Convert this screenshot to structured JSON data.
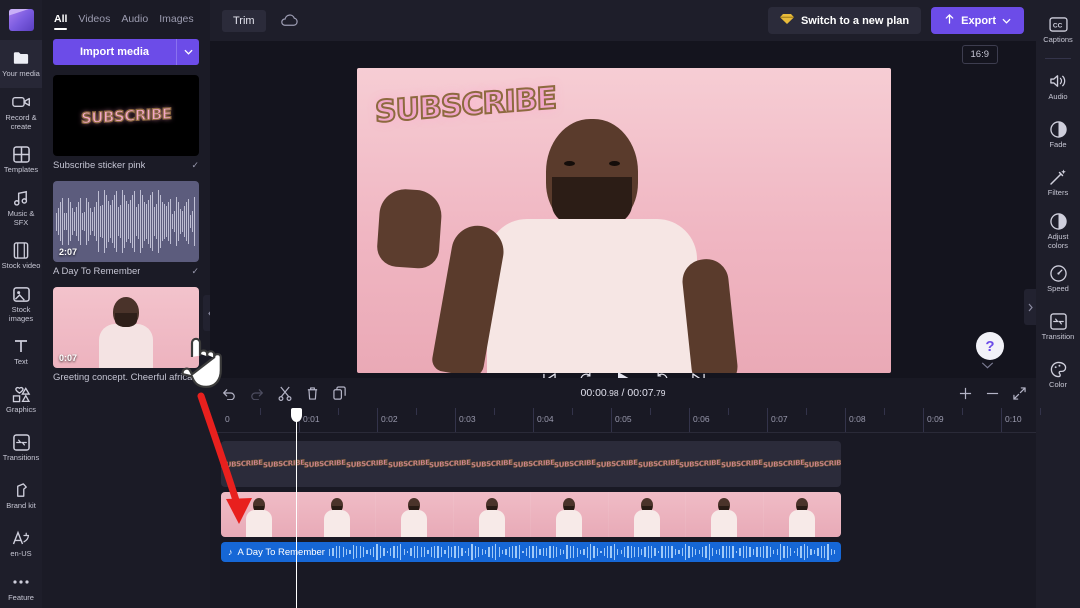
{
  "app": {
    "name": "Clipchamp video editor",
    "logo_icon": "clipchamp-logo"
  },
  "rail": {
    "items": [
      {
        "label": "Your media",
        "icon": "folder-icon",
        "active": true
      },
      {
        "label": "Record & create",
        "icon": "camera-icon",
        "active": false
      },
      {
        "label": "Templates",
        "icon": "grid-icon",
        "active": false
      },
      {
        "label": "Music & SFX",
        "icon": "music-note-icon",
        "active": false
      },
      {
        "label": "Stock video",
        "icon": "film-icon",
        "active": false
      },
      {
        "label": "Stock images",
        "icon": "image-icon",
        "active": false
      },
      {
        "label": "Text",
        "icon": "text-t-icon",
        "active": false
      },
      {
        "label": "Graphics",
        "icon": "shapes-icon",
        "active": false
      },
      {
        "label": "Transitions",
        "icon": "transition-icon",
        "active": false
      },
      {
        "label": "Brand kit",
        "icon": "brand-kit-icon",
        "active": false
      }
    ],
    "bottom": [
      {
        "label": "en-US",
        "icon": "language-icon"
      },
      {
        "label": "Feature",
        "icon": "more-dots-icon"
      }
    ]
  },
  "media_panel": {
    "tabs": [
      {
        "label": "All",
        "active": true
      },
      {
        "label": "Videos",
        "active": false
      },
      {
        "label": "Audio",
        "active": false
      },
      {
        "label": "Images",
        "active": false
      }
    ],
    "import_label": "Import media",
    "import_caret_icon": "chevron-down-icon",
    "items": [
      {
        "name": "Subscribe sticker pink",
        "kind": "sticker",
        "duration": "",
        "added_icon": "check-icon",
        "sticker_text": "SUBSCRIBE"
      },
      {
        "name": "A Day To Remember",
        "kind": "audio",
        "duration": "2:07",
        "added_icon": "check-icon"
      },
      {
        "name": "Greeting concept. Cheerful africa",
        "kind": "video",
        "duration": "0:07",
        "added_icon": "check-icon"
      }
    ],
    "collapse_icon": "chevron-left-icon"
  },
  "topbar": {
    "trim_label": "Trim",
    "cloud_icon": "cloud-saved-icon",
    "plan_label": "Switch to a new plan",
    "plan_icon": "diamond-icon",
    "export_label": "Export",
    "export_icon": "upload-icon",
    "export_caret_icon": "chevron-down-icon"
  },
  "preview": {
    "aspect_ratio": "16:9",
    "subscribe_text": "SUBSCRIBE",
    "controls": [
      {
        "name": "skip-to-start",
        "icon": "skip-start-icon"
      },
      {
        "name": "rewind-5",
        "icon": "rewind-5-icon"
      },
      {
        "name": "play",
        "icon": "play-icon"
      },
      {
        "name": "forward-5",
        "icon": "forward-5-icon"
      },
      {
        "name": "skip-to-end",
        "icon": "skip-end-icon"
      }
    ],
    "fullscreen_icon": "fullscreen-icon",
    "help_label": "?",
    "collapse_down_icon": "chevron-down-icon",
    "right_collapse_icon": "chevron-right-icon"
  },
  "right_rail": {
    "items": [
      {
        "label": "Captions",
        "icon": "cc-icon"
      },
      {
        "label": "Audio",
        "icon": "speaker-icon"
      },
      {
        "label": "Fade",
        "icon": "fade-icon"
      },
      {
        "label": "Filters",
        "icon": "magic-wand-icon"
      },
      {
        "label": "Adjust colors",
        "icon": "contrast-icon"
      },
      {
        "label": "Speed",
        "icon": "speedometer-icon"
      },
      {
        "label": "Transition",
        "icon": "transition-icon"
      },
      {
        "label": "Color",
        "icon": "palette-icon"
      }
    ]
  },
  "timeline": {
    "toolbar": [
      {
        "name": "undo",
        "icon": "undo-icon",
        "enabled": true
      },
      {
        "name": "redo",
        "icon": "redo-icon",
        "enabled": false
      },
      {
        "name": "split",
        "icon": "scissors-icon",
        "enabled": true
      },
      {
        "name": "delete",
        "icon": "trash-icon",
        "enabled": true
      },
      {
        "name": "duplicate",
        "icon": "duplicate-icon",
        "enabled": true
      }
    ],
    "current_time": "00:00",
    "current_time_frac": ".98",
    "separator": " / ",
    "total_time": "00:07",
    "total_time_frac": ".79",
    "zoom_in_icon": "plus-icon",
    "zoom_out_icon": "minus-icon",
    "fit_icon": "fit-to-screen-icon",
    "ruler_labels": [
      "0",
      "0:01",
      "0:02",
      "0:03",
      "0:04",
      "0:05",
      "0:06",
      "0:07",
      "0:08",
      "0:09",
      "0:10"
    ],
    "playhead_position_label": "0:01",
    "tracks": [
      {
        "name": "Subscribe sticker pink",
        "type": "sticker",
        "repeat_text": "SUBSCRIBE",
        "frames": 15
      },
      {
        "name": "Greeting concept. Cheerful africa",
        "type": "video",
        "frames": 8
      },
      {
        "name": "A Day To Remember",
        "type": "audio",
        "note_icon": "music-note-icon"
      }
    ]
  },
  "annotations": {
    "cursor_icon": "pointing-hand-cursor",
    "arrow_color": "#e8201e"
  }
}
